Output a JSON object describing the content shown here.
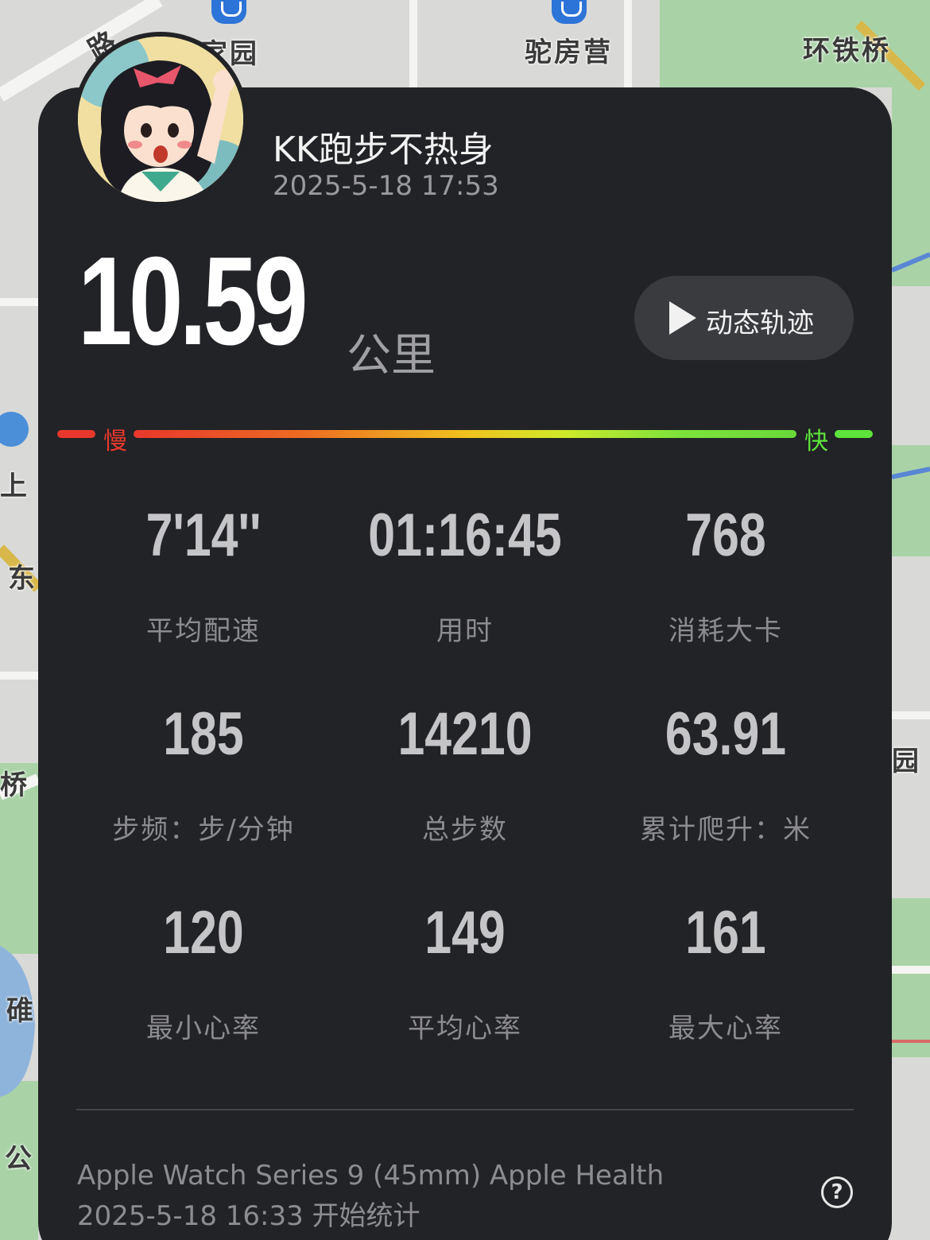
{
  "map": {
    "labels": [
      "家园",
      "驼房营",
      "环铁桥",
      "上",
      "东",
      "桥",
      "园",
      "碓",
      "公",
      "路"
    ]
  },
  "profile": {
    "name": "KK跑步不热身",
    "posted_at": "2025-5-18 17:53"
  },
  "run": {
    "distance": "10.59",
    "distance_unit": "公里",
    "track_button_label": "动态轨迹"
  },
  "speed_bar": {
    "slow_label": "慢",
    "fast_label": "快"
  },
  "stats": [
    {
      "value": "7'14''",
      "label": "平均配速"
    },
    {
      "value": "01:16:45",
      "label": "用时"
    },
    {
      "value": "768",
      "label": "消耗大卡"
    },
    {
      "value": "185",
      "label": "步频：步/分钟"
    },
    {
      "value": "14210",
      "label": "总步数"
    },
    {
      "value": "63.91",
      "label": "累计爬升：米"
    },
    {
      "value": "120",
      "label": "最小心率"
    },
    {
      "value": "149",
      "label": "平均心率"
    },
    {
      "value": "161",
      "label": "最大心率"
    }
  ],
  "footer": {
    "device": "Apple Watch Series 9 (45mm) Apple Health",
    "start_time": "2025-5-18 16:33 开始统计",
    "help_glyph": "?"
  },
  "colors": {
    "card_bg": "#222326",
    "slow": "#e8382c",
    "fast": "#5de43c"
  }
}
